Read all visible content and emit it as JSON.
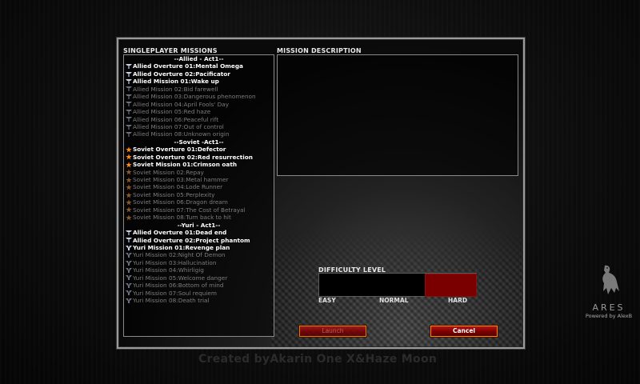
{
  "dialog": {
    "missions_title": "SINGLEPLAYER MISSIONS",
    "description_title": "MISSION DESCRIPTION",
    "description_text": ""
  },
  "missions": [
    {
      "kind": "header",
      "text": "--Allied - Act1--"
    },
    {
      "kind": "available",
      "faction": "allied",
      "text": "Allied Overture 01:Mental Omega"
    },
    {
      "kind": "available",
      "faction": "allied",
      "text": "Allied Overture 02:Pacificator"
    },
    {
      "kind": "available",
      "faction": "allied",
      "text": "Allied Mission 01:Wake up"
    },
    {
      "kind": "locked",
      "faction": "allied",
      "text": "Allied Mission 02:Bid farewell"
    },
    {
      "kind": "locked",
      "faction": "allied",
      "text": "Allied Mission 03:Dangerous phenomenon"
    },
    {
      "kind": "locked",
      "faction": "allied",
      "text": "Allied Mission 04:April Fools' Day"
    },
    {
      "kind": "locked",
      "faction": "allied",
      "text": "Allied Mission 05:Red haze"
    },
    {
      "kind": "locked",
      "faction": "allied",
      "text": "Allied Mission 06:Peaceful rift"
    },
    {
      "kind": "locked",
      "faction": "allied",
      "text": "Allied Mission 07:Out of control"
    },
    {
      "kind": "locked",
      "faction": "allied",
      "text": "Allied Mission 08:Unknown origin"
    },
    {
      "kind": "header",
      "text": "--Soviet -Act1--"
    },
    {
      "kind": "available",
      "faction": "soviet",
      "text": "Soviet Overture 01:Defector"
    },
    {
      "kind": "available",
      "faction": "soviet",
      "text": "Soviet Overture 02:Red resurrection"
    },
    {
      "kind": "available",
      "faction": "soviet",
      "text": "Soviet Mission 01:Crimson oath"
    },
    {
      "kind": "locked",
      "faction": "soviet",
      "text": "Soviet Mission 02:Repay"
    },
    {
      "kind": "locked",
      "faction": "soviet",
      "text": "Soviet Mission 03:Metal hammer"
    },
    {
      "kind": "locked",
      "faction": "soviet",
      "text": "Soviet Mission 04:Lode Runner"
    },
    {
      "kind": "locked",
      "faction": "soviet",
      "text": "Soviet Mission 05:Perplexity"
    },
    {
      "kind": "locked",
      "faction": "soviet",
      "text": "Soviet Mission 06:Dragon dream"
    },
    {
      "kind": "locked",
      "faction": "soviet",
      "text": "Soviet Mission 07:The Cost of Betrayal"
    },
    {
      "kind": "locked",
      "faction": "soviet",
      "text": "Soviet Mission 08:Turn back to hit"
    },
    {
      "kind": "header",
      "text": "--Yuri - Act1--"
    },
    {
      "kind": "available",
      "faction": "allied",
      "text": "Allied Overture 01:Dead end"
    },
    {
      "kind": "available",
      "faction": "allied",
      "text": "Allied Overture 02:Project phantom"
    },
    {
      "kind": "available",
      "faction": "yuri",
      "text": "Yuri Mission 01:Revenge plan"
    },
    {
      "kind": "locked",
      "faction": "yuri",
      "text": "Yuri Mission 02:Night Of Demon"
    },
    {
      "kind": "locked",
      "faction": "yuri",
      "text": "Yuri Mission 03:Hallucination"
    },
    {
      "kind": "locked",
      "faction": "yuri",
      "text": "Yuri Mission 04:Whirligig"
    },
    {
      "kind": "locked",
      "faction": "yuri",
      "text": "Yuri Mission 05:Welcome danger"
    },
    {
      "kind": "locked",
      "faction": "yuri",
      "text": "Yuri Mission 06:Bottom of mind"
    },
    {
      "kind": "locked",
      "faction": "yuri",
      "text": "Yuri Mission 07:Soul requiem"
    },
    {
      "kind": "locked",
      "faction": "yuri",
      "text": "Yuri Mission 08:Death trial"
    }
  ],
  "difficulty": {
    "title": "DIFFICULTY LEVEL",
    "easy": "EASY",
    "normal": "NORMAL",
    "hard": "HARD",
    "selected": "HARD",
    "selected_color": "#7a0000"
  },
  "buttons": {
    "launch": "Launch",
    "cancel": "Cancel"
  },
  "footer": {
    "credit": "Created byAkarin One X&Haze Moon"
  },
  "branding": {
    "title": "ARES",
    "subtitle": "Powered by AlexB"
  },
  "icons": {
    "allied": "allied-eagle-icon",
    "soviet": "soviet-star-icon",
    "yuri": "yuri-emblem-icon",
    "brand": "vulture-logo-icon"
  },
  "colors": {
    "available_text": "#ffffff",
    "locked_text": "#7d7d7d",
    "button_border": "#ff8a00",
    "button_fill": "#8a0000"
  }
}
